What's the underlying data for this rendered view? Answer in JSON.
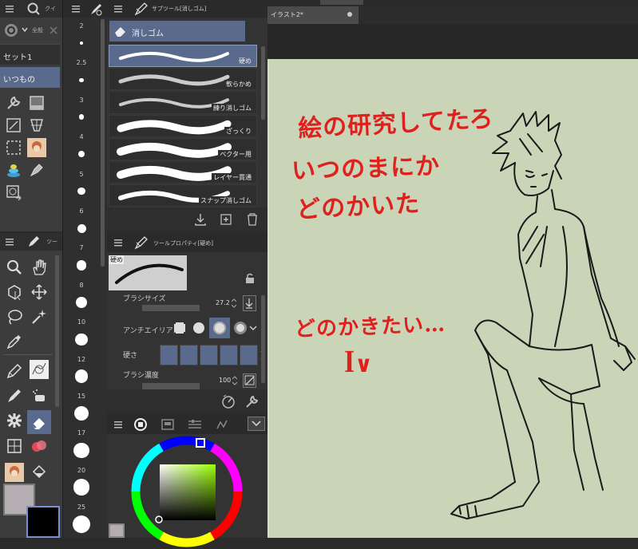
{
  "quick_access": {
    "tab_label": "クイ",
    "search_placeholder": "全般",
    "set_label": "セット1",
    "selected_item": "いつもの"
  },
  "tool_panel": {
    "tab_label": "ツー"
  },
  "brush_size_panel": {
    "sizes": [
      "2",
      "2.5",
      "3",
      "4",
      "5",
      "6",
      "7",
      "8",
      "10",
      "12",
      "15",
      "17",
      "20",
      "25"
    ]
  },
  "sub_tool_panel": {
    "tab_label": "サブツール[消しゴム]",
    "header_label": "消しゴム",
    "items": [
      {
        "label": "硬め"
      },
      {
        "label": "軟らかめ"
      },
      {
        "label": "練り消しゴム"
      },
      {
        "label": "ざっくり"
      },
      {
        "label": "ベクター用"
      },
      {
        "label": "レイヤー貫通"
      },
      {
        "label": "スナップ消しゴム"
      }
    ]
  },
  "tool_property": {
    "tab_label": "ツールプロパティ[硬め]",
    "preview_label": "硬め",
    "brush_size_label": "ブラシサイズ",
    "brush_size_value": "27.2",
    "antialias_label": "アンチエイリアス",
    "hardness_label": "硬さ",
    "brush_density_label": "ブラシ濃度",
    "brush_density_value": "100"
  },
  "canvas": {
    "tab_title": "イラスト2*",
    "handwritten_text": [
      "絵の研究してたろ",
      "いつのまにか",
      "どのかいた",
      "どのかきたい…",
      "ꟾ∨"
    ]
  },
  "colors": {
    "canvas_bg": "#cad5b8",
    "ink_red": "#e0201c",
    "selection_blue": "#5a6a8c",
    "main_color": "#b4aeb2",
    "sub_color": "#000000"
  }
}
